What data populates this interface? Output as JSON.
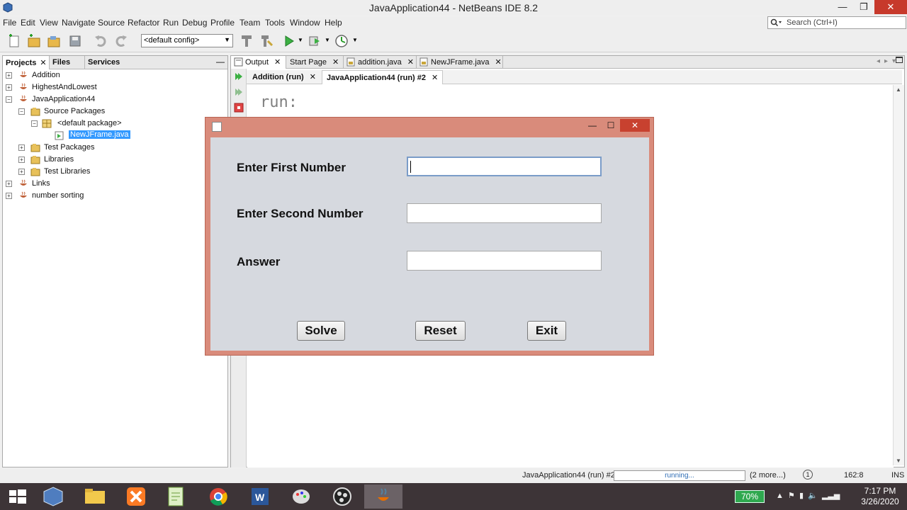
{
  "window": {
    "title": "JavaApplication44 - NetBeans IDE 8.2",
    "minimize": "—",
    "maximize": "❐",
    "close": "✕"
  },
  "menu": [
    "File",
    "Edit",
    "View",
    "Navigate",
    "Source",
    "Refactor",
    "Run",
    "Debug",
    "Profile",
    "Team",
    "Tools",
    "Window",
    "Help"
  ],
  "search": {
    "placeholder": "Search (Ctrl+I)"
  },
  "toolbar": {
    "config": "<default config>"
  },
  "left_tabs": {
    "projects": "Projects",
    "files": "Files",
    "services": "Services",
    "close": "✕",
    "minimize": "—"
  },
  "tree": [
    {
      "label": "Addition",
      "expander": "+"
    },
    {
      "label": "HighestAndLowest",
      "expander": "+"
    },
    {
      "label": "JavaApplication44",
      "expander": "−"
    },
    {
      "label": "Source Packages",
      "expander": "−"
    },
    {
      "label": "<default package>",
      "expander": "−"
    },
    {
      "label": "NewJFrame.java",
      "expander": ""
    },
    {
      "label": "Test Packages",
      "expander": "+"
    },
    {
      "label": "Libraries",
      "expander": "+"
    },
    {
      "label": "Test Libraries",
      "expander": "+"
    },
    {
      "label": "Links",
      "expander": "+"
    },
    {
      "label": "number sorting",
      "expander": "+"
    }
  ],
  "doc_tabs": [
    {
      "label": "Output",
      "close": "✕"
    },
    {
      "label": "Start Page",
      "close": "✕"
    },
    {
      "label": "addition.java",
      "close": "✕"
    },
    {
      "label": "NewJFrame.java",
      "close": "✕"
    }
  ],
  "output_tabs": [
    {
      "label": "Addition (run)",
      "close": "✕"
    },
    {
      "label": "JavaApplication44 (run) #2",
      "close": "✕"
    }
  ],
  "console": {
    "text": "run:"
  },
  "status": {
    "process": "JavaApplication44 (run) #2",
    "progress": "running...",
    "more": "(2 more...)",
    "notif": "1",
    "position": "162:8",
    "mode": "INS"
  },
  "jframe": {
    "minimize": "—",
    "maximize": "☐",
    "close": "✕",
    "label_first": "Enter First Number",
    "label_second": "Enter Second Number",
    "label_answer": "Answer",
    "first_value": "",
    "second_value": "",
    "answer_value": "",
    "btn_solve": "Solve",
    "btn_reset": "Reset",
    "btn_exit": "Exit"
  },
  "taskbar": {
    "battery": "70%",
    "time": "7:17 PM",
    "date": "3/26/2020",
    "apps": [
      "start-icon",
      "virtualbox-icon",
      "file-explorer-icon",
      "xampp-icon",
      "notepad-plus-icon",
      "chrome-icon",
      "word-icon",
      "paint-icon",
      "obs-icon",
      "java-icon"
    ]
  },
  "colors": {
    "accent": "#3399ff",
    "frame_border": "#d98b7b",
    "close_red": "#c7392b",
    "taskbar": "#3d3437"
  }
}
